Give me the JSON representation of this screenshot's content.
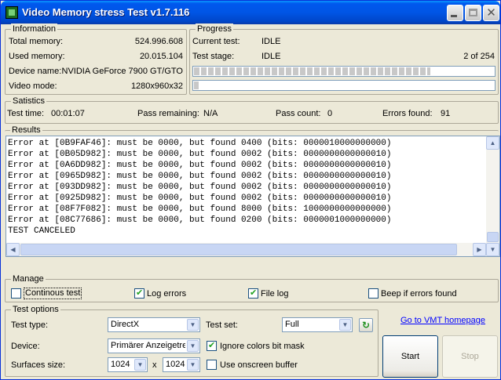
{
  "window": {
    "title": "Video Memory stress Test v1.7.116"
  },
  "information": {
    "legend": "Information",
    "total_memory_label": "Total memory:",
    "total_memory_value": "524.996.608",
    "used_memory_label": "Used memory:",
    "used_memory_value": "20.015.104",
    "device_name_label": "Device name:",
    "device_name_value": "NVIDIA GeForce 7900 GT/GTO",
    "video_mode_label": "Video mode:",
    "video_mode_value": "1280x960x32"
  },
  "progress": {
    "legend": "Progress",
    "current_test_label": "Current test:",
    "current_test_value": "IDLE",
    "test_stage_label": "Test stage:",
    "test_stage_value": "IDLE",
    "stage_counter": "2 of 254",
    "bar1_fill": 0.79,
    "bar2_fill": 0.01
  },
  "statistics": {
    "legend": "Satistics",
    "test_time_label": "Test time:",
    "test_time_value": "00:01:07",
    "pass_remaining_label": "Pass remaining:",
    "pass_remaining_value": "N/A",
    "pass_count_label": "Pass count:",
    "pass_count_value": "0",
    "errors_found_label": "Errors found:",
    "errors_found_value": "91"
  },
  "results": {
    "legend": "Results",
    "log_text": "Error at [0B9FAF46]: must be 0000, but found 0400 (bits: 0000010000000000)\nError at [0B05D982]: must be 0000, but found 0002 (bits: 0000000000000010)\nError at [0A6DD982]: must be 0000, but found 0002 (bits: 0000000000000010)\nError at [0965D982]: must be 0000, but found 0002 (bits: 0000000000000010)\nError at [093DD982]: must be 0000, but found 0002 (bits: 0000000000000010)\nError at [0925D982]: must be 0000, but found 0002 (bits: 0000000000000010)\nError at [08F7F082]: must be 0000, but found 8000 (bits: 1000000000000000)\nError at [08C77686]: must be 0000, but found 0200 (bits: 0000001000000000)\nTEST CANCELED"
  },
  "manage": {
    "legend": "Manage",
    "continuous_test_label": "Continous test",
    "continuous_test_checked": false,
    "log_errors_label": "Log errors",
    "log_errors_checked": true,
    "file_log_label": "File log",
    "file_log_checked": true,
    "beep_label": "Beep if errors found",
    "beep_checked": false
  },
  "test_options": {
    "legend": "Test options",
    "test_type_label": "Test type:",
    "test_type_value": "DirectX",
    "test_set_label": "Test set:",
    "test_set_value": "Full",
    "device_label": "Device:",
    "device_value": "Primärer Anzeigetreiber",
    "ignore_colors_label": "Ignore colors bit mask",
    "ignore_colors_checked": true,
    "surfaces_label": "Surfaces size:",
    "surface_width_value": "1024",
    "surface_x": "x",
    "surface_height_value": "1024",
    "onscreen_label": "Use onscreen buffer",
    "onscreen_checked": false
  },
  "actions": {
    "homepage_link": "Go to VMT homepage",
    "start_label": "Start",
    "stop_label": "Stop"
  }
}
